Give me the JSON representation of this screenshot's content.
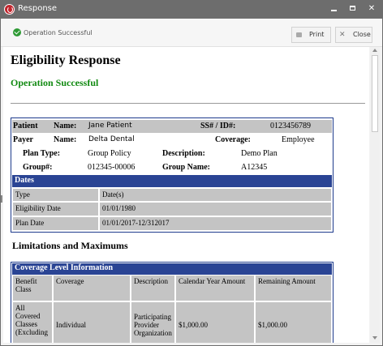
{
  "window": {
    "title": "Response"
  },
  "toolbar": {
    "status": "Operation Successful",
    "print_label": "Print",
    "close_label": "Close"
  },
  "page": {
    "title": "Eligibility Response",
    "status": "Operation Successful"
  },
  "summary": {
    "patient_label": "Patient",
    "name_label": "Name:",
    "patient_name": "Jane Patient",
    "ssn_label": "SS# / ID#:",
    "ssn_value": "0123456789",
    "payer_label": "Payer",
    "payer_name": "Delta Dental",
    "coverage_label": "Coverage:",
    "coverage_value": "Employee",
    "plan_type_label": "Plan Type:",
    "plan_type_value": "Group Policy",
    "description_label": "Description:",
    "description_value": "Demo Plan",
    "group_label": "Group#:",
    "group_value": "012345-00006",
    "group_name_label": "Group Name:",
    "group_name_value": "A12345"
  },
  "dates": {
    "header": "Dates",
    "columns": [
      "Type",
      "Date(s)"
    ],
    "rows": [
      [
        "Eligibility Date",
        "01/01/1980"
      ],
      [
        "Plan Date",
        "01/01/2017-12/312017"
      ]
    ]
  },
  "limitations": {
    "title": "Limitations and Maximums",
    "header": "Coverage Level Information",
    "columns": [
      "Benefit Class",
      "Coverage",
      "Description",
      "Calendar Year Amount",
      "Remaining Amount"
    ],
    "rows": [
      [
        "All Covered Classes (Excluding",
        "Individual",
        "Participating Provider Organization",
        "$1,000.00",
        "$1,000.00"
      ]
    ]
  },
  "icons": {
    "app": "app-logo-icon",
    "status": "check-circle-icon",
    "print": "printer-icon",
    "close": "close-icon"
  },
  "colors": {
    "titlebar": "#6d6d6d",
    "section_header": "#2a4494",
    "success": "#128a12",
    "row_fill": "#c4c4c4"
  }
}
